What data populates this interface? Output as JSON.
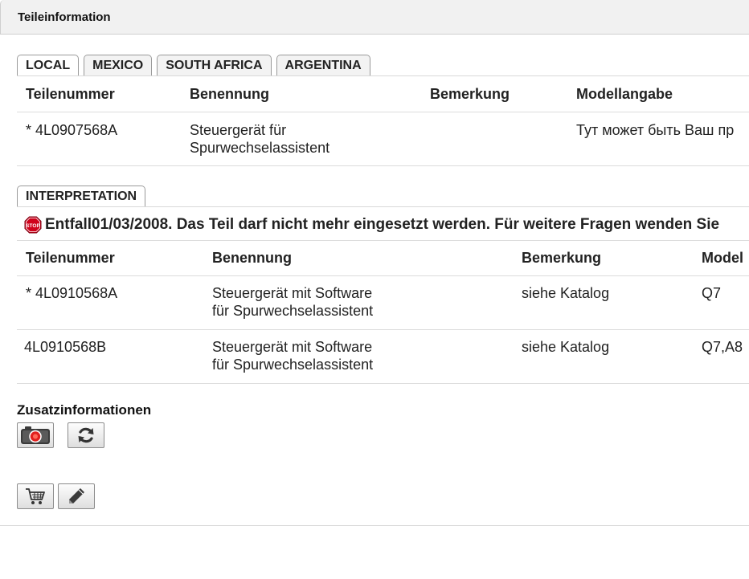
{
  "window": {
    "title": "Teileinformation"
  },
  "market_tabs": [
    {
      "label": "LOCAL",
      "active": true
    },
    {
      "label": "MEXICO",
      "active": false
    },
    {
      "label": "SOUTH AFRICA",
      "active": false
    },
    {
      "label": "ARGENTINA",
      "active": false
    }
  ],
  "part_table": {
    "headers": [
      "Teilenummer",
      "Benennung",
      "Bemerkung",
      "Modellangabe"
    ],
    "rows": [
      [
        "* 4L0907568A",
        "Steuergerät für\nSpurwechselassistent",
        "",
        "Тут может быть Ваш пр"
      ]
    ]
  },
  "interpretation_tab": {
    "label": "INTERPRETATION"
  },
  "notice": {
    "text": "Entfall01/03/2008. Das Teil darf nicht mehr eingesetzt werden. Für weitere Fragen wenden Sie",
    "icon": "stop-sign-icon"
  },
  "interpretation_table": {
    "headers": [
      "Teilenummer",
      "Benennung",
      "Bemerkung",
      "Model"
    ],
    "rows": [
      [
        "* 4L0910568A",
        "Steuergerät mit Software\nfür Spurwechselassistent",
        "siehe Katalog",
        "Q7"
      ],
      [
        "4L0910568B",
        "Steuergerät mit Software\nfür Spurwechselassistent",
        "siehe Katalog",
        "Q7,A8"
      ]
    ]
  },
  "additional": {
    "label": "Zusatzinformationen",
    "buttons": [
      {
        "icon": "camera-icon"
      },
      {
        "icon": "refresh-icon"
      }
    ]
  },
  "actions": {
    "buttons": [
      {
        "icon": "shopping-cart-icon"
      },
      {
        "icon": "pencil-icon"
      }
    ]
  },
  "colors": {
    "stop_red": "#d0021b",
    "camera_red": "#e0201e",
    "border": "#dcdcdc"
  }
}
